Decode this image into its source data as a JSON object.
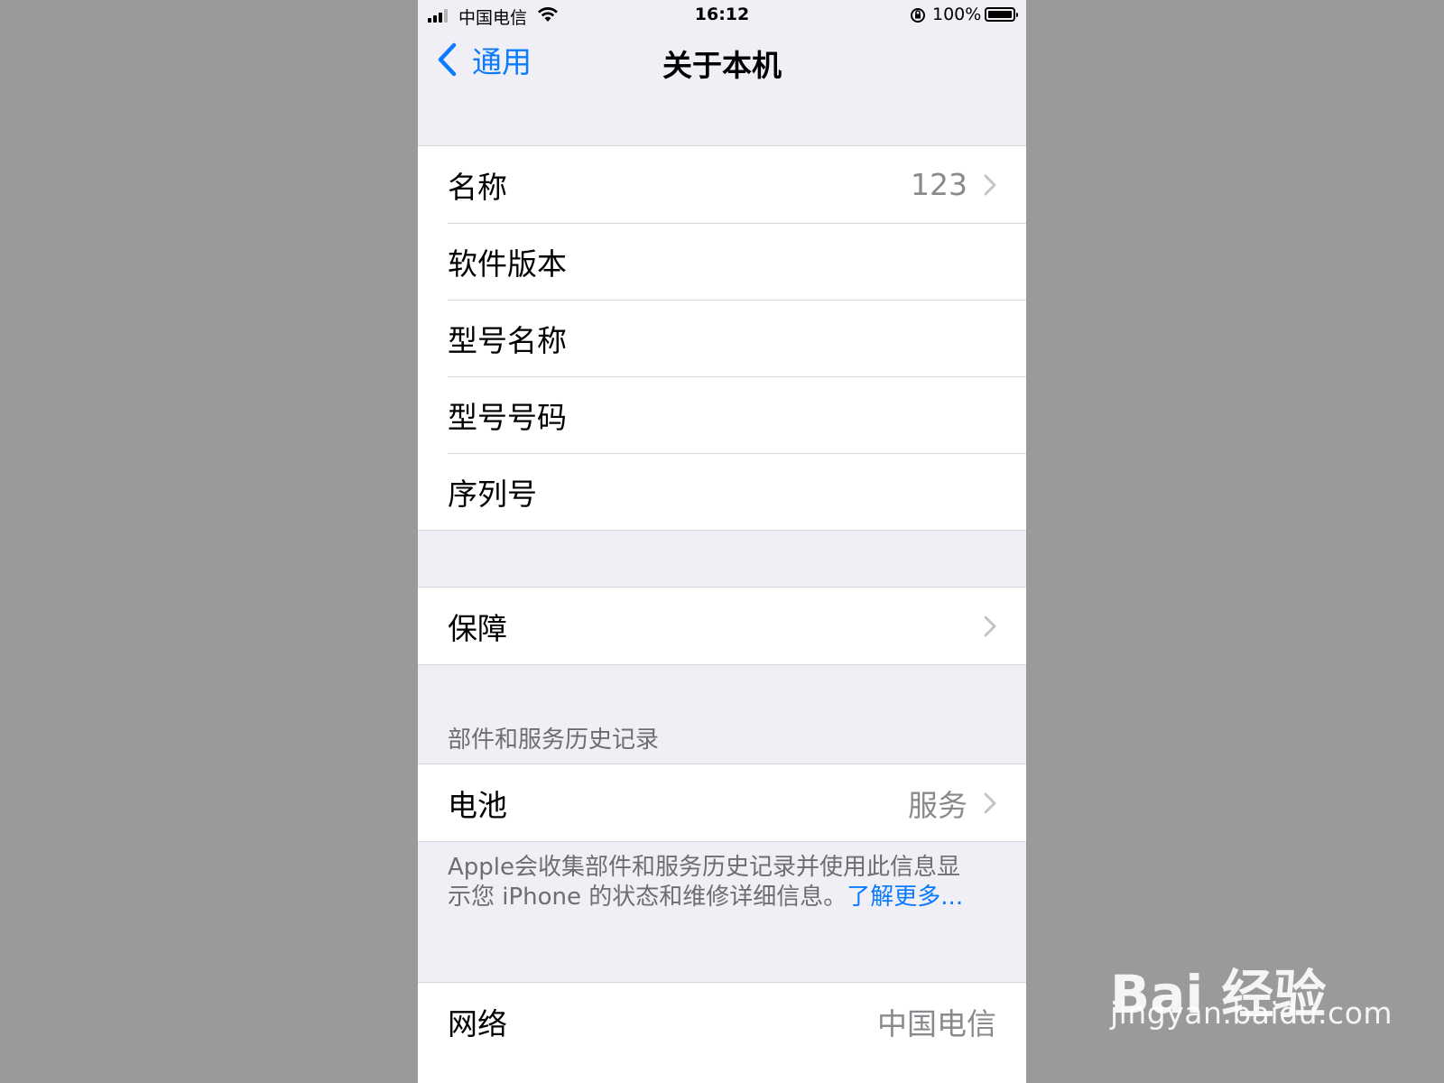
{
  "status_bar": {
    "carrier": "中国电信",
    "time": "16:12",
    "battery_percent": "100%"
  },
  "nav": {
    "back_label": "通用",
    "title": "关于本机"
  },
  "group1": {
    "rows": [
      {
        "label": "名称",
        "value": "123"
      },
      {
        "label": "软件版本",
        "value": ""
      },
      {
        "label": "型号名称",
        "value": ""
      },
      {
        "label": "型号号码",
        "value": ""
      },
      {
        "label": "序列号",
        "value": ""
      }
    ]
  },
  "group2": {
    "rows": [
      {
        "label": "保障",
        "value": ""
      }
    ]
  },
  "parts_section": {
    "header": "部件和服务历史记录",
    "rows": [
      {
        "label": "电池",
        "value": "服务"
      }
    ],
    "footer_text": "Apple会收集部件和服务历史记录并使用此信息显示您 iPhone 的状态和维修详细信息。",
    "footer_link": "了解更多..."
  },
  "group4": {
    "rows": [
      {
        "label": "网络",
        "value": "中国电信"
      }
    ]
  },
  "watermark": {
    "logo": "Bai 经验",
    "url": "jingyan.baidu.com"
  },
  "colors": {
    "accent": "#0a7aff",
    "background": "#f0eff5",
    "secondary_text": "#8a8a8e"
  }
}
